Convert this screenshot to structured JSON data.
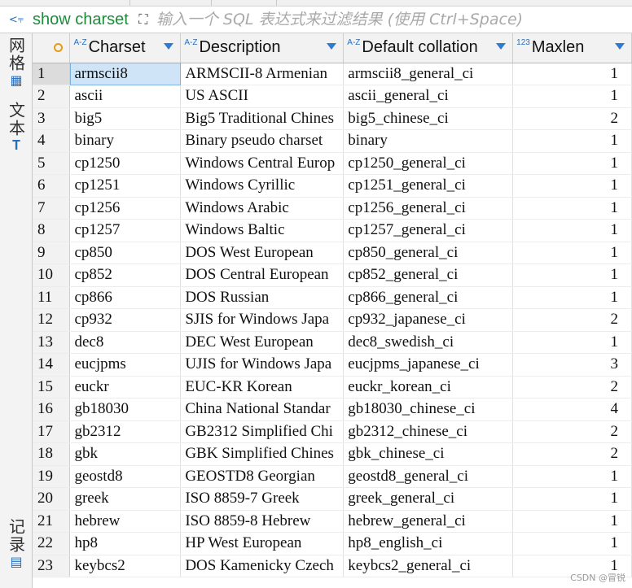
{
  "toolbar": {
    "query_label": "show charset",
    "filter_placeholder": "输入一个 SQL 表达式来过滤结果 (使用 Ctrl+Space)"
  },
  "sidebar": {
    "grid_label": "网格",
    "text_label": "文本",
    "record_label": "记录"
  },
  "columns": [
    {
      "label": "Charset",
      "type": "A-Z"
    },
    {
      "label": "Description",
      "type": "A-Z"
    },
    {
      "label": "Default collation",
      "type": "A-Z"
    },
    {
      "label": "Maxlen",
      "type": "123"
    }
  ],
  "rows": [
    {
      "n": "1",
      "charset": "armscii8",
      "description": "ARMSCII-8 Armenian",
      "collation": "armscii8_general_ci",
      "maxlen": "1"
    },
    {
      "n": "2",
      "charset": "ascii",
      "description": "US ASCII",
      "collation": "ascii_general_ci",
      "maxlen": "1"
    },
    {
      "n": "3",
      "charset": "big5",
      "description": "Big5 Traditional Chines",
      "collation": "big5_chinese_ci",
      "maxlen": "2"
    },
    {
      "n": "4",
      "charset": "binary",
      "description": "Binary pseudo charset",
      "collation": "binary",
      "maxlen": "1"
    },
    {
      "n": "5",
      "charset": "cp1250",
      "description": "Windows Central Europ",
      "collation": "cp1250_general_ci",
      "maxlen": "1"
    },
    {
      "n": "6",
      "charset": "cp1251",
      "description": "Windows Cyrillic",
      "collation": "cp1251_general_ci",
      "maxlen": "1"
    },
    {
      "n": "7",
      "charset": "cp1256",
      "description": "Windows Arabic",
      "collation": "cp1256_general_ci",
      "maxlen": "1"
    },
    {
      "n": "8",
      "charset": "cp1257",
      "description": "Windows Baltic",
      "collation": "cp1257_general_ci",
      "maxlen": "1"
    },
    {
      "n": "9",
      "charset": "cp850",
      "description": "DOS West European",
      "collation": "cp850_general_ci",
      "maxlen": "1"
    },
    {
      "n": "10",
      "charset": "cp852",
      "description": "DOS Central European",
      "collation": "cp852_general_ci",
      "maxlen": "1"
    },
    {
      "n": "11",
      "charset": "cp866",
      "description": "DOS Russian",
      "collation": "cp866_general_ci",
      "maxlen": "1"
    },
    {
      "n": "12",
      "charset": "cp932",
      "description": "SJIS for Windows Japa",
      "collation": "cp932_japanese_ci",
      "maxlen": "2"
    },
    {
      "n": "13",
      "charset": "dec8",
      "description": "DEC West European",
      "collation": "dec8_swedish_ci",
      "maxlen": "1"
    },
    {
      "n": "14",
      "charset": "eucjpms",
      "description": "UJIS for Windows Japa",
      "collation": "eucjpms_japanese_ci",
      "maxlen": "3"
    },
    {
      "n": "15",
      "charset": "euckr",
      "description": "EUC-KR Korean",
      "collation": "euckr_korean_ci",
      "maxlen": "2"
    },
    {
      "n": "16",
      "charset": "gb18030",
      "description": "China National Standar",
      "collation": "gb18030_chinese_ci",
      "maxlen": "4"
    },
    {
      "n": "17",
      "charset": "gb2312",
      "description": "GB2312 Simplified Chi",
      "collation": "gb2312_chinese_ci",
      "maxlen": "2"
    },
    {
      "n": "18",
      "charset": "gbk",
      "description": "GBK Simplified Chines",
      "collation": "gbk_chinese_ci",
      "maxlen": "2"
    },
    {
      "n": "19",
      "charset": "geostd8",
      "description": "GEOSTD8 Georgian",
      "collation": "geostd8_general_ci",
      "maxlen": "1"
    },
    {
      "n": "20",
      "charset": "greek",
      "description": "ISO 8859-7 Greek",
      "collation": "greek_general_ci",
      "maxlen": "1"
    },
    {
      "n": "21",
      "charset": "hebrew",
      "description": "ISO 8859-8 Hebrew",
      "collation": "hebrew_general_ci",
      "maxlen": "1"
    },
    {
      "n": "22",
      "charset": "hp8",
      "description": "HP West European",
      "collation": "hp8_english_ci",
      "maxlen": "1"
    },
    {
      "n": "23",
      "charset": "keybcs2",
      "description": "DOS Kamenicky Czech",
      "collation": "keybcs2_general_ci",
      "maxlen": "1"
    }
  ],
  "selected_row": 1,
  "watermark": "CSDN @冒锐",
  "colors": {
    "accent": "#2e7bd1",
    "query_green": "#1e8b3a",
    "selection": "#cfe4f7"
  }
}
